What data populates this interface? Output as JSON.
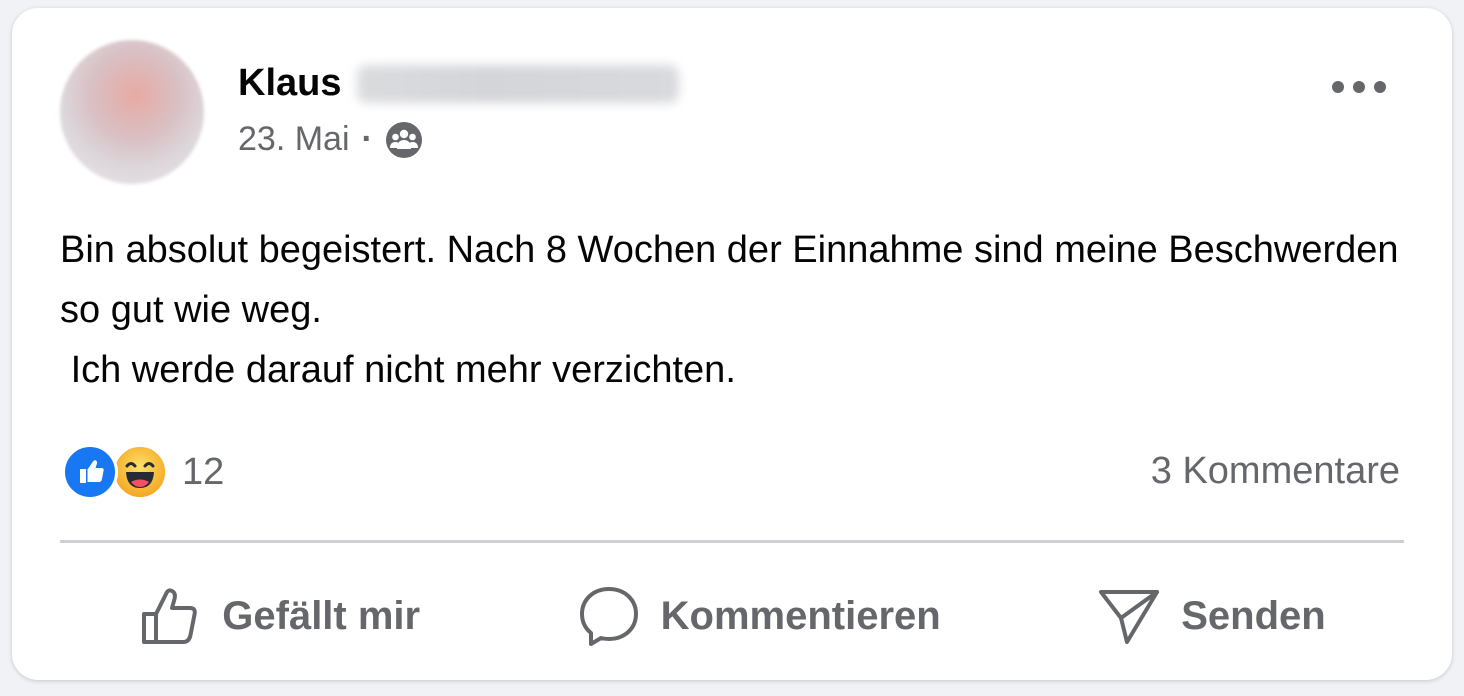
{
  "post": {
    "author_first_name": "Klaus",
    "date": "23. Mai",
    "separator": "·",
    "audience_icon": "friends-icon",
    "text": "Bin absolut begeistert. Nach 8 Wochen der Einnahme sind meine Beschwerden so gut wie weg.\n Ich werde darauf nicht mehr verzichten."
  },
  "stats": {
    "reaction_icons": [
      "like-reaction-icon",
      "haha-reaction-icon"
    ],
    "reaction_count": "12",
    "comment_count": "3 Kommentare"
  },
  "actions": {
    "like_label": "Gefällt mir",
    "comment_label": "Kommentieren",
    "share_label": "Senden"
  },
  "colors": {
    "text_primary": "#050505",
    "text_secondary": "#65676b",
    "like_blue": "#1877f2",
    "haha_yellow": "#f7b125",
    "divider": "#ced0d4"
  }
}
